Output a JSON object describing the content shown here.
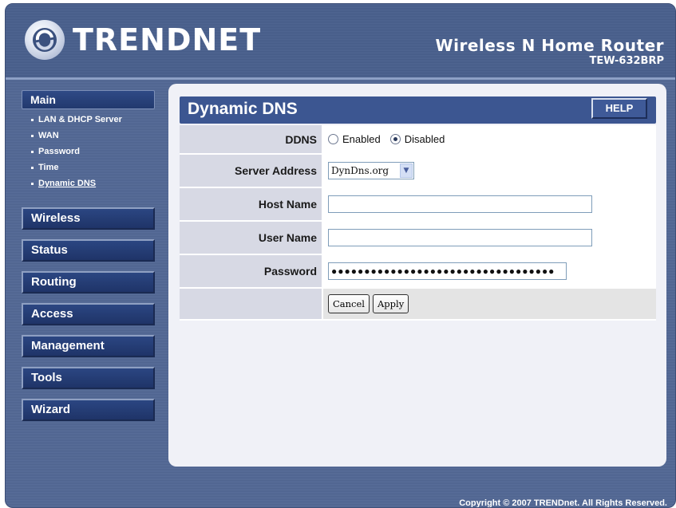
{
  "brand": {
    "logo_text": "TRENDNET"
  },
  "product": {
    "name": "Wireless N Home Router",
    "model": "TEW-632BRP"
  },
  "sidebar": {
    "main_label": "Main",
    "sub_items": [
      {
        "label": "LAN & DHCP Server"
      },
      {
        "label": "WAN"
      },
      {
        "label": "Password"
      },
      {
        "label": "Time"
      },
      {
        "label": "Dynamic DNS",
        "active": true
      }
    ],
    "sections": [
      {
        "label": "Wireless"
      },
      {
        "label": "Status"
      },
      {
        "label": "Routing"
      },
      {
        "label": "Access"
      },
      {
        "label": "Management"
      },
      {
        "label": "Tools"
      },
      {
        "label": "Wizard"
      }
    ]
  },
  "page": {
    "title": "Dynamic DNS",
    "help_label": "HELP"
  },
  "form": {
    "ddns_label": "DDNS",
    "ddns_options": {
      "enabled": "Enabled",
      "disabled": "Disabled",
      "selected": "Disabled"
    },
    "server_label": "Server Address",
    "server_value": "DynDns.org",
    "host_label": "Host Name",
    "host_value": "",
    "user_label": "User Name",
    "user_value": "",
    "password_label": "Password",
    "password_value": "●●●●●●●●●●●●●●●●●●●●●●●●●●●●●●●●●●",
    "cancel_label": "Cancel",
    "apply_label": "Apply"
  },
  "footer": {
    "copyright": "Copyright © 2007 TRENDnet. All Rights Reserved."
  },
  "colors": {
    "header_bg": "#4d628e",
    "title_bar": "#3c5691",
    "panel_bg": "#f0f1f7"
  }
}
